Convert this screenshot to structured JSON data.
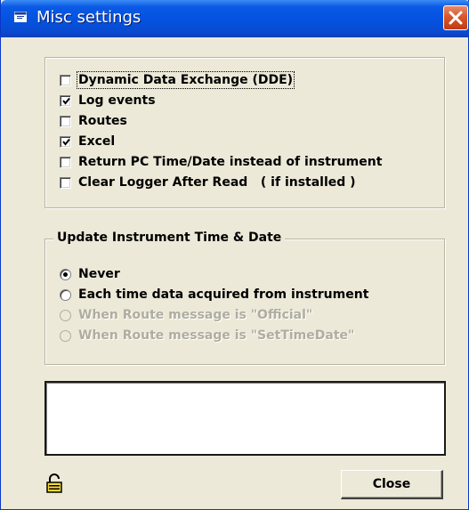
{
  "window": {
    "title": "Misc settings"
  },
  "options": {
    "items": [
      {
        "label": "Dynamic Data Exchange (DDE)",
        "checked": false
      },
      {
        "label": "Log events",
        "checked": true
      },
      {
        "label": "Routes",
        "checked": false
      },
      {
        "label": "Excel",
        "checked": true
      },
      {
        "label": "Return PC Time/Date instead of instrument",
        "checked": false
      },
      {
        "label": "Clear Logger After Read   ( if installed )",
        "checked": false
      }
    ]
  },
  "update_time": {
    "legend": "Update Instrument Time & Date",
    "choices": [
      {
        "label": "Never",
        "selected": true,
        "enabled": true
      },
      {
        "label": "Each time data acquired from instrument",
        "selected": false,
        "enabled": true
      },
      {
        "label": "When Route message is \"Official\"",
        "selected": false,
        "enabled": false
      },
      {
        "label": "When Route message is \"SetTimeDate\"",
        "selected": false,
        "enabled": false
      }
    ]
  },
  "message_box": {
    "value": ""
  },
  "footer": {
    "lock_icon": "padlock-icon",
    "close_label": "Close"
  },
  "colors": {
    "titlebar": "#0452df",
    "face": "#ece9d8",
    "close_x": "#d8582c"
  }
}
